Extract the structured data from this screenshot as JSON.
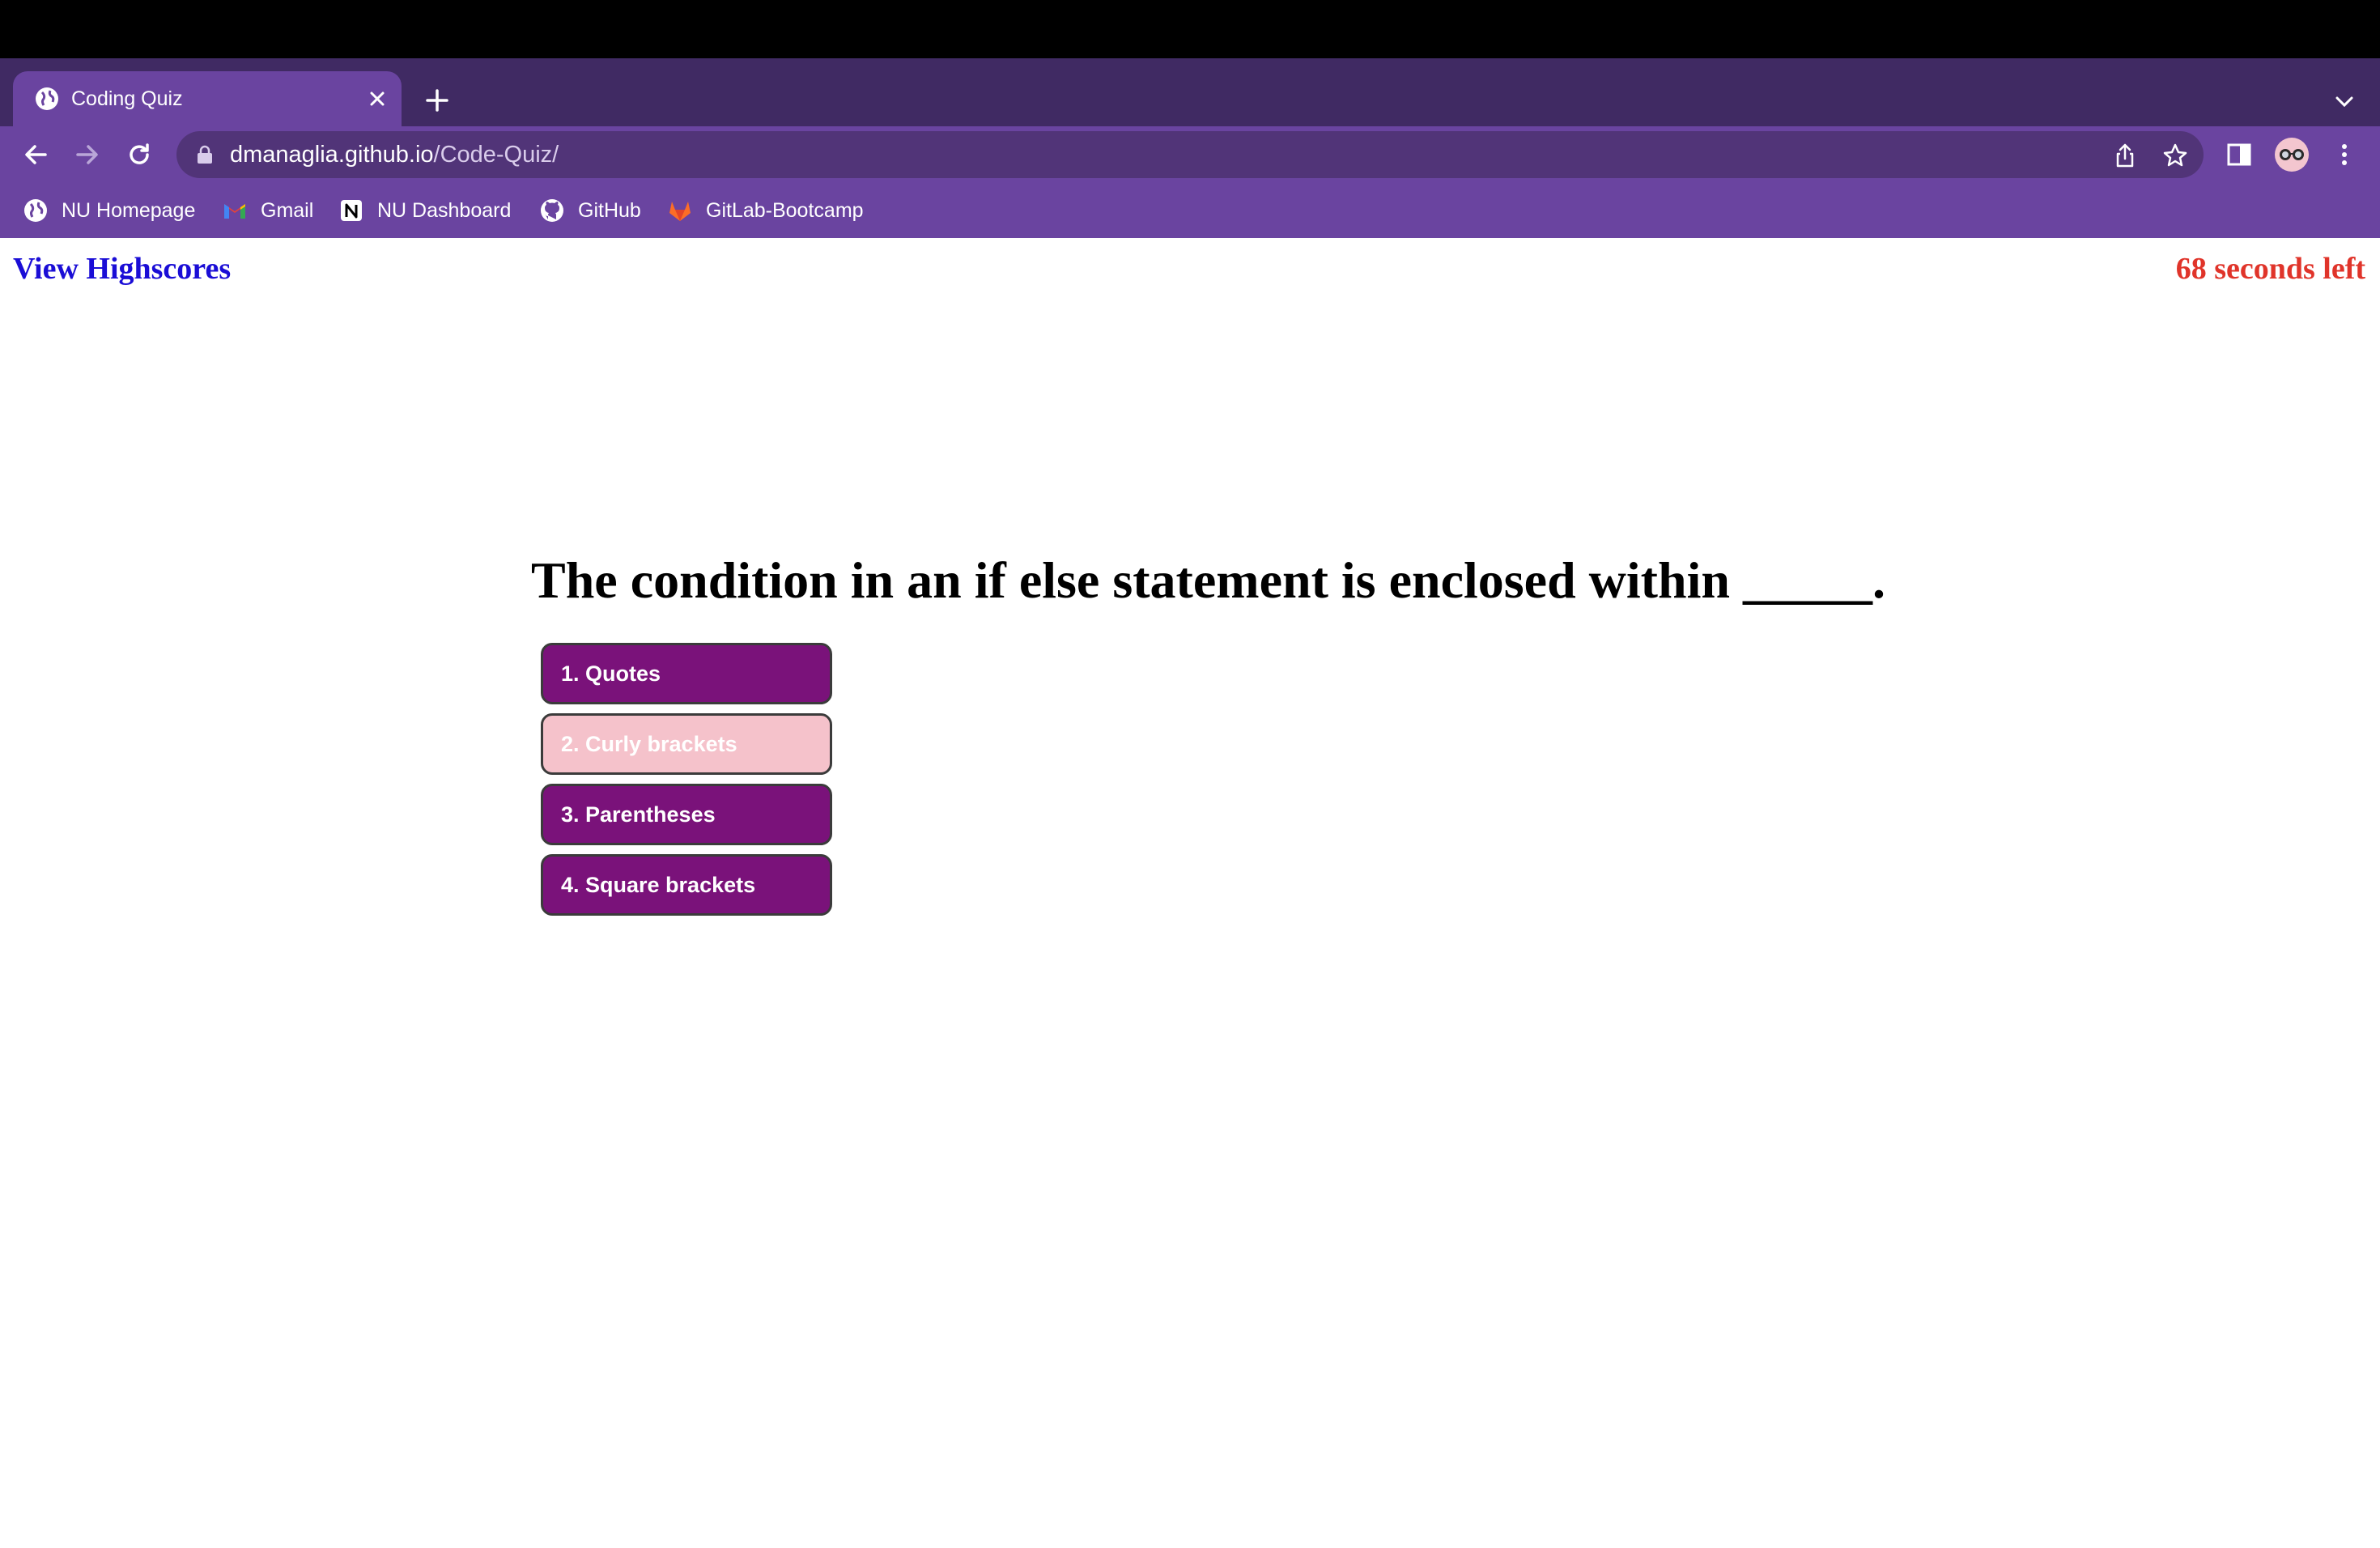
{
  "browser": {
    "tab": {
      "title": "Coding Quiz"
    },
    "url": {
      "host": "dmanaglia.github.io",
      "path": "/Code-Quiz/"
    },
    "bookmarks": [
      {
        "label": "NU Homepage",
        "icon": "globe-icon"
      },
      {
        "label": "Gmail",
        "icon": "gmail-icon"
      },
      {
        "label": "NU Dashboard",
        "icon": "notion-icon"
      },
      {
        "label": "GitHub",
        "icon": "github-icon"
      },
      {
        "label": "GitLab-Bootcamp",
        "icon": "gitlab-icon"
      }
    ],
    "colors": {
      "frame": "#402a63",
      "active_tab": "#6a44a0",
      "omnibox": "#513478"
    }
  },
  "quiz": {
    "highscores_link": "View Highscores",
    "timer_text": "68 seconds left",
    "question": "The condition in an if else statement is enclosed within _____.",
    "answers": [
      {
        "label": "1. Quotes",
        "selected": false
      },
      {
        "label": "2. Curly brackets",
        "selected": true
      },
      {
        "label": "3. Parentheses",
        "selected": false
      },
      {
        "label": "4. Square brackets",
        "selected": false
      }
    ],
    "colors": {
      "answer_bg": "#7a127a",
      "answer_selected_bg": "#f5c2cb",
      "link": "#1a0dd6",
      "timer": "#e0342a"
    }
  }
}
